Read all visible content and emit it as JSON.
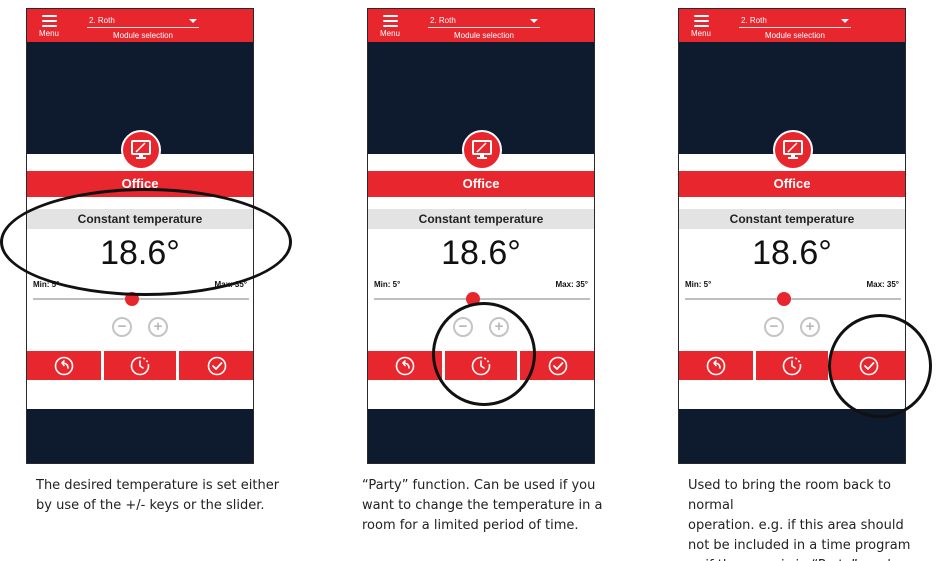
{
  "colors": {
    "accent": "#e8262e",
    "dark": "#0e1a2e",
    "mode_bar": "#e3e3e3"
  },
  "panels": [
    {
      "menu_label": "Menu",
      "module_value": "2. Roth",
      "module_label": "Module selection",
      "room_name": "Office",
      "mode": "Constant temperature",
      "temperature": "18.6°",
      "min_label": "Min: 5°",
      "max_label": "Max: 35°",
      "slider_fraction": 0.46,
      "caption": "The desired temperature is set either\nby use of the +/- keys or the slider."
    },
    {
      "menu_label": "Menu",
      "module_value": "2. Roth",
      "module_label": "Module selection",
      "room_name": "Office",
      "mode": "Constant temperature",
      "temperature": "18.6°",
      "min_label": "Min: 5°",
      "max_label": "Max: 35°",
      "slider_fraction": 0.46,
      "caption": "“Party” function. Can be used if you\nwant to change the temperature in a\nroom for a limited period of time."
    },
    {
      "menu_label": "Menu",
      "module_value": "2. Roth",
      "module_label": "Module selection",
      "room_name": "Office",
      "mode": "Constant temperature",
      "temperature": "18.6°",
      "min_label": "Min: 5°",
      "max_label": "Max: 35°",
      "slider_fraction": 0.46,
      "caption": "Used to bring the room back to normal\noperation. e.g. if this area should\nnot be included in a time program\nor if the room is in “Party” mode."
    }
  ],
  "icons": {
    "menu": "hamburger-icon",
    "dropdown": "chevron-down-icon",
    "room": "monitor-icon",
    "minus": "minus-icon",
    "plus": "plus-icon",
    "back": "back-arrow-icon",
    "party": "clock-icon",
    "normal": "checkmark-icon"
  }
}
